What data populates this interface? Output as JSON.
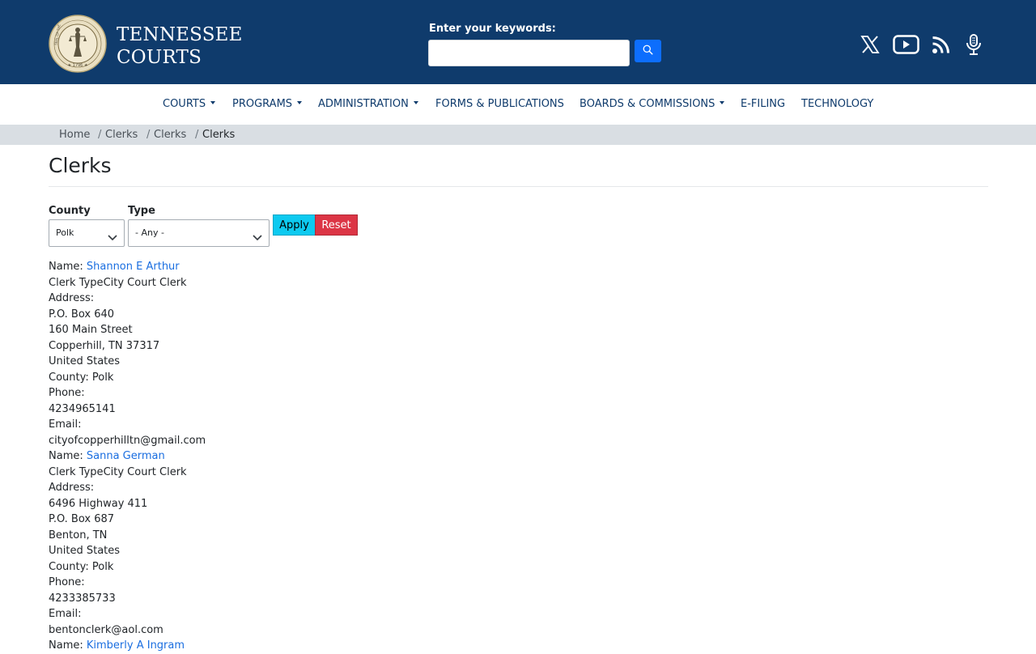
{
  "header": {
    "logo_line1": "TENNESSEE",
    "logo_line2": "COURTS",
    "seal_text": "SEAL OF THE TENNESSEE JUDICIARY",
    "seal_year": "1796",
    "search_label": "Enter your keywords:",
    "search_value": "",
    "search_placeholder": "",
    "social_icons": [
      "x-icon",
      "youtube-icon",
      "rss-icon",
      "podcast-icon"
    ]
  },
  "nav": {
    "items": [
      {
        "label": "COURTS",
        "dropdown": true
      },
      {
        "label": "PROGRAMS",
        "dropdown": true
      },
      {
        "label": "ADMINISTRATION",
        "dropdown": true
      },
      {
        "label": "FORMS & PUBLICATIONS",
        "dropdown": false
      },
      {
        "label": "BOARDS & COMMISSIONS",
        "dropdown": true
      },
      {
        "label": "E-FILING",
        "dropdown": false
      },
      {
        "label": "TECHNOLOGY",
        "dropdown": false
      }
    ]
  },
  "breadcrumb": [
    "Home",
    "Clerks",
    "Clerks",
    "Clerks"
  ],
  "page_title": "Clerks",
  "filters": {
    "county_label": "County",
    "county_value": "Polk",
    "type_label": "Type",
    "type_value": "- Any -",
    "apply_label": "Apply",
    "reset_label": "Reset"
  },
  "labels": {
    "name": "Name: ",
    "clerk_type": "Clerk Type",
    "address": "Address:",
    "county": "County: ",
    "phone": "Phone:",
    "email": "Email:"
  },
  "clerks": [
    {
      "name": "Shannon E Arthur",
      "type": "City Court Clerk",
      "address": [
        "P.O. Box 640",
        "160 Main Street",
        "Copperhill, TN 37317",
        "United States"
      ],
      "county": "Polk",
      "phone": "4234965141",
      "email": "cityofcopperhilltn@gmail.com"
    },
    {
      "name": "Sanna German",
      "type": "City Court Clerk",
      "address": [
        "6496 Highway 411",
        "P.O. Box 687",
        "Benton, TN",
        "United States"
      ],
      "county": "Polk",
      "phone": "4233385733",
      "email": "bentonclerk@aol.com"
    },
    {
      "name": "Kimberly A Ingram"
    }
  ],
  "colors": {
    "header_bg": "#0f3b6c",
    "link": "#1a6ee0",
    "apply_bg": "#0dcaf0",
    "reset_bg": "#dc3545",
    "search_button_bg": "#0d6efd",
    "breadcrumb_bg": "#d9dee3"
  }
}
